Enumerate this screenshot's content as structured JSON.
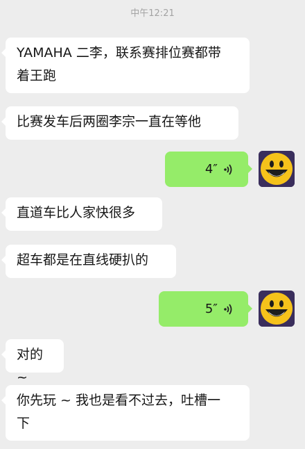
{
  "chat": {
    "timestamp": "中午12:21",
    "messages": [
      {
        "side": "left",
        "type": "text",
        "lines": [
          "YAMAHA 二李，联系赛排位赛都带",
          "着王跑"
        ]
      },
      {
        "side": "left",
        "type": "text",
        "lines": [
          "比赛发车后两圈李宗一直在等他"
        ]
      },
      {
        "side": "right",
        "type": "voice",
        "duration": "4″"
      },
      {
        "side": "left",
        "type": "text",
        "lines": [
          "直道车比人家快很多"
        ]
      },
      {
        "side": "left",
        "type": "text",
        "lines": [
          "超车都是在直线硬扒的"
        ]
      },
      {
        "side": "right",
        "type": "voice",
        "duration": "5″"
      },
      {
        "side": "left",
        "type": "text",
        "lines": [
          "对的 ~"
        ]
      },
      {
        "side": "left",
        "type": "text",
        "lines": [
          "你先玩 ~ 我也是看不过去，吐槽一",
          "下"
        ]
      }
    ]
  },
  "colors": {
    "background": "#ededed",
    "incoming_bubble": "#ffffff",
    "outgoing_bubble": "#95ec69",
    "avatar_face": "#f5c21b"
  },
  "icons": {
    "avatar": "smiley-face-icon",
    "voice": "voice-wave-icon"
  }
}
